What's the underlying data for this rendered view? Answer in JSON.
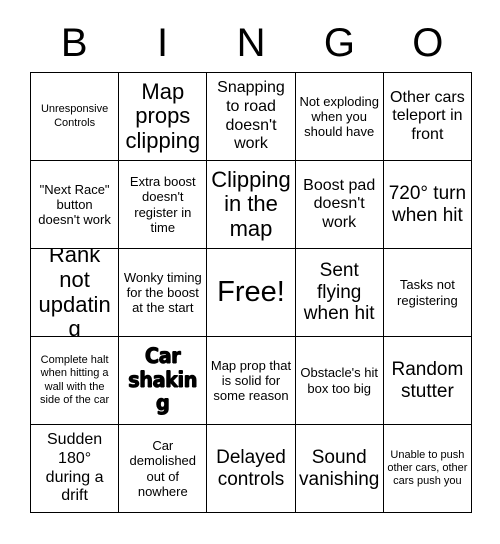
{
  "header": {
    "letters": [
      "B",
      "I",
      "N",
      "G",
      "O"
    ]
  },
  "grid": {
    "rows": 5,
    "columns": 5,
    "cells": [
      {
        "text": "Unresponsive Controls",
        "size": "xs",
        "style": "normal"
      },
      {
        "text": "Map props clipping",
        "size": "xl",
        "style": "normal"
      },
      {
        "text": "Snapping to road doesn't work",
        "size": "md",
        "style": "normal"
      },
      {
        "text": "Not exploding when you should have",
        "size": "sm",
        "style": "normal"
      },
      {
        "text": "Other cars teleport in front",
        "size": "md",
        "style": "normal"
      },
      {
        "text": "\"Next Race\" button doesn't work",
        "size": "sm",
        "style": "normal"
      },
      {
        "text": "Extra boost doesn't register in time",
        "size": "sm",
        "style": "normal"
      },
      {
        "text": "Clipping in the map",
        "size": "xl",
        "style": "normal"
      },
      {
        "text": "Boost pad doesn't work",
        "size": "md",
        "style": "normal"
      },
      {
        "text": "720° turn when hit",
        "size": "lg",
        "style": "normal"
      },
      {
        "text": "Rank not updating",
        "size": "xl",
        "style": "normal"
      },
      {
        "text": "Wonky timing for the boost at the start",
        "size": "sm",
        "style": "normal"
      },
      {
        "text": "Free!",
        "size": "xxl",
        "style": "normal"
      },
      {
        "text": "Sent flying when hit",
        "size": "lg",
        "style": "normal"
      },
      {
        "text": "Tasks not registering",
        "size": "sm",
        "style": "normal"
      },
      {
        "text": "Complete halt when hitting a wall with the side of the car",
        "size": "xs",
        "style": "normal"
      },
      {
        "text": "Car shaking",
        "size": "lg",
        "style": "heavy"
      },
      {
        "text": "Map prop that is solid for some reason",
        "size": "sm",
        "style": "normal"
      },
      {
        "text": "Obstacle's hit box too big",
        "size": "sm",
        "style": "normal"
      },
      {
        "text": "Random stutter",
        "size": "lg",
        "style": "normal"
      },
      {
        "text": "Sudden 180° during a drift",
        "size": "md",
        "style": "normal"
      },
      {
        "text": "Car demolished out of nowhere",
        "size": "sm",
        "style": "normal"
      },
      {
        "text": "Delayed controls",
        "size": "lg",
        "style": "normal"
      },
      {
        "text": "Sound vanishing",
        "size": "lg",
        "style": "normal"
      },
      {
        "text": "Unable to push other cars, other cars push you",
        "size": "xs",
        "style": "normal"
      }
    ]
  }
}
